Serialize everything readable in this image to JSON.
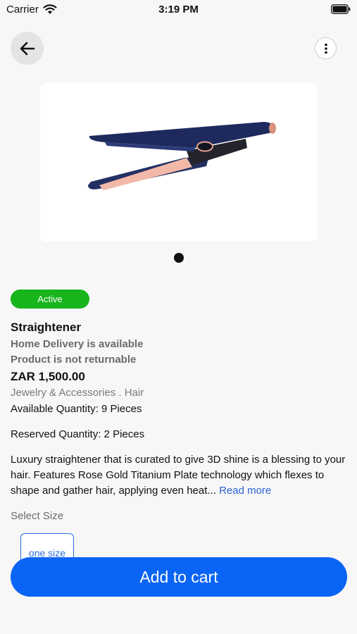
{
  "status_bar": {
    "carrier": "Carrier",
    "time": "3:19 PM"
  },
  "product": {
    "status_badge": "Active",
    "name": "Straightener",
    "delivery": "Home Delivery is available",
    "returnable": "Product is not returnable",
    "price": "ZAR 1,500.00",
    "category": "Jewelry & Accessories  . Hair",
    "available_quantity": "Available Quantity:  9 Pieces",
    "reserved_quantity": "Reserved Quantity:  2 Pieces",
    "description": "Luxury straightener that is curated to give 3D shine is a blessing to your hair. Features Rose Gold Titanium Plate technology which flexes to shape and gather hair, applying even heat...",
    "read_more": "Read more"
  },
  "size_selector": {
    "label": "Select Size",
    "options": [
      "one size"
    ]
  },
  "actions": {
    "add_to_cart": "Add to cart"
  },
  "colors": {
    "active_badge": "#18b41c",
    "primary": "#0a64f5",
    "link": "#2a5fd0"
  },
  "icons": {
    "back": "arrow-left-icon",
    "more": "vertical-dots-icon",
    "wifi": "wifi-icon",
    "battery": "battery-icon"
  }
}
